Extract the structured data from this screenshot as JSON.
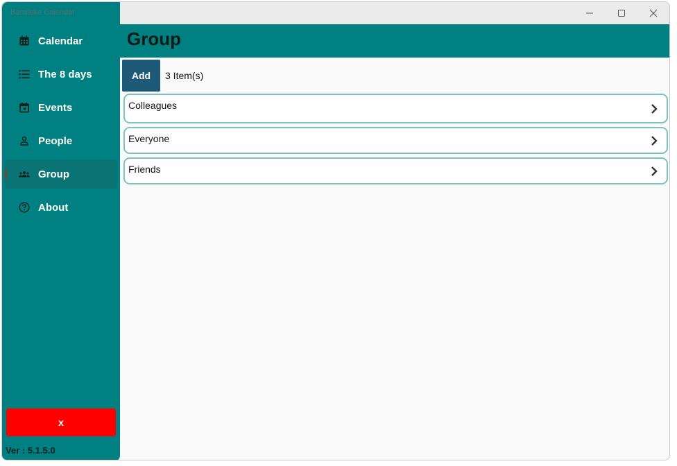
{
  "window": {
    "title": "Bamileke Calendar",
    "controls": {
      "minimize": "—",
      "maximize": "☐",
      "close": "✕"
    }
  },
  "sidebar": {
    "items": [
      {
        "label": "Calendar",
        "icon": "calendar-icon",
        "active": false
      },
      {
        "label": "The 8 days",
        "icon": "list-icon",
        "active": false
      },
      {
        "label": "Events",
        "icon": "event-icon",
        "active": false
      },
      {
        "label": "People",
        "icon": "person-icon",
        "active": false
      },
      {
        "label": "Group",
        "icon": "group-icon",
        "active": true
      },
      {
        "label": "About",
        "icon": "help-circle-icon",
        "active": false
      }
    ],
    "close_label": "x",
    "version": "Ver : 5.1.5.0"
  },
  "header": {
    "title": "Group"
  },
  "toolbar": {
    "add_label": "Add",
    "count": "3 Item(s)"
  },
  "groups": [
    {
      "name": "Colleagues"
    },
    {
      "name": "Everyone"
    },
    {
      "name": "Friends"
    }
  ],
  "colors": {
    "accent": "#008080",
    "close_button": "#ff0000",
    "add_button": "#1e5a78",
    "row_border": "#7cc3bc"
  }
}
